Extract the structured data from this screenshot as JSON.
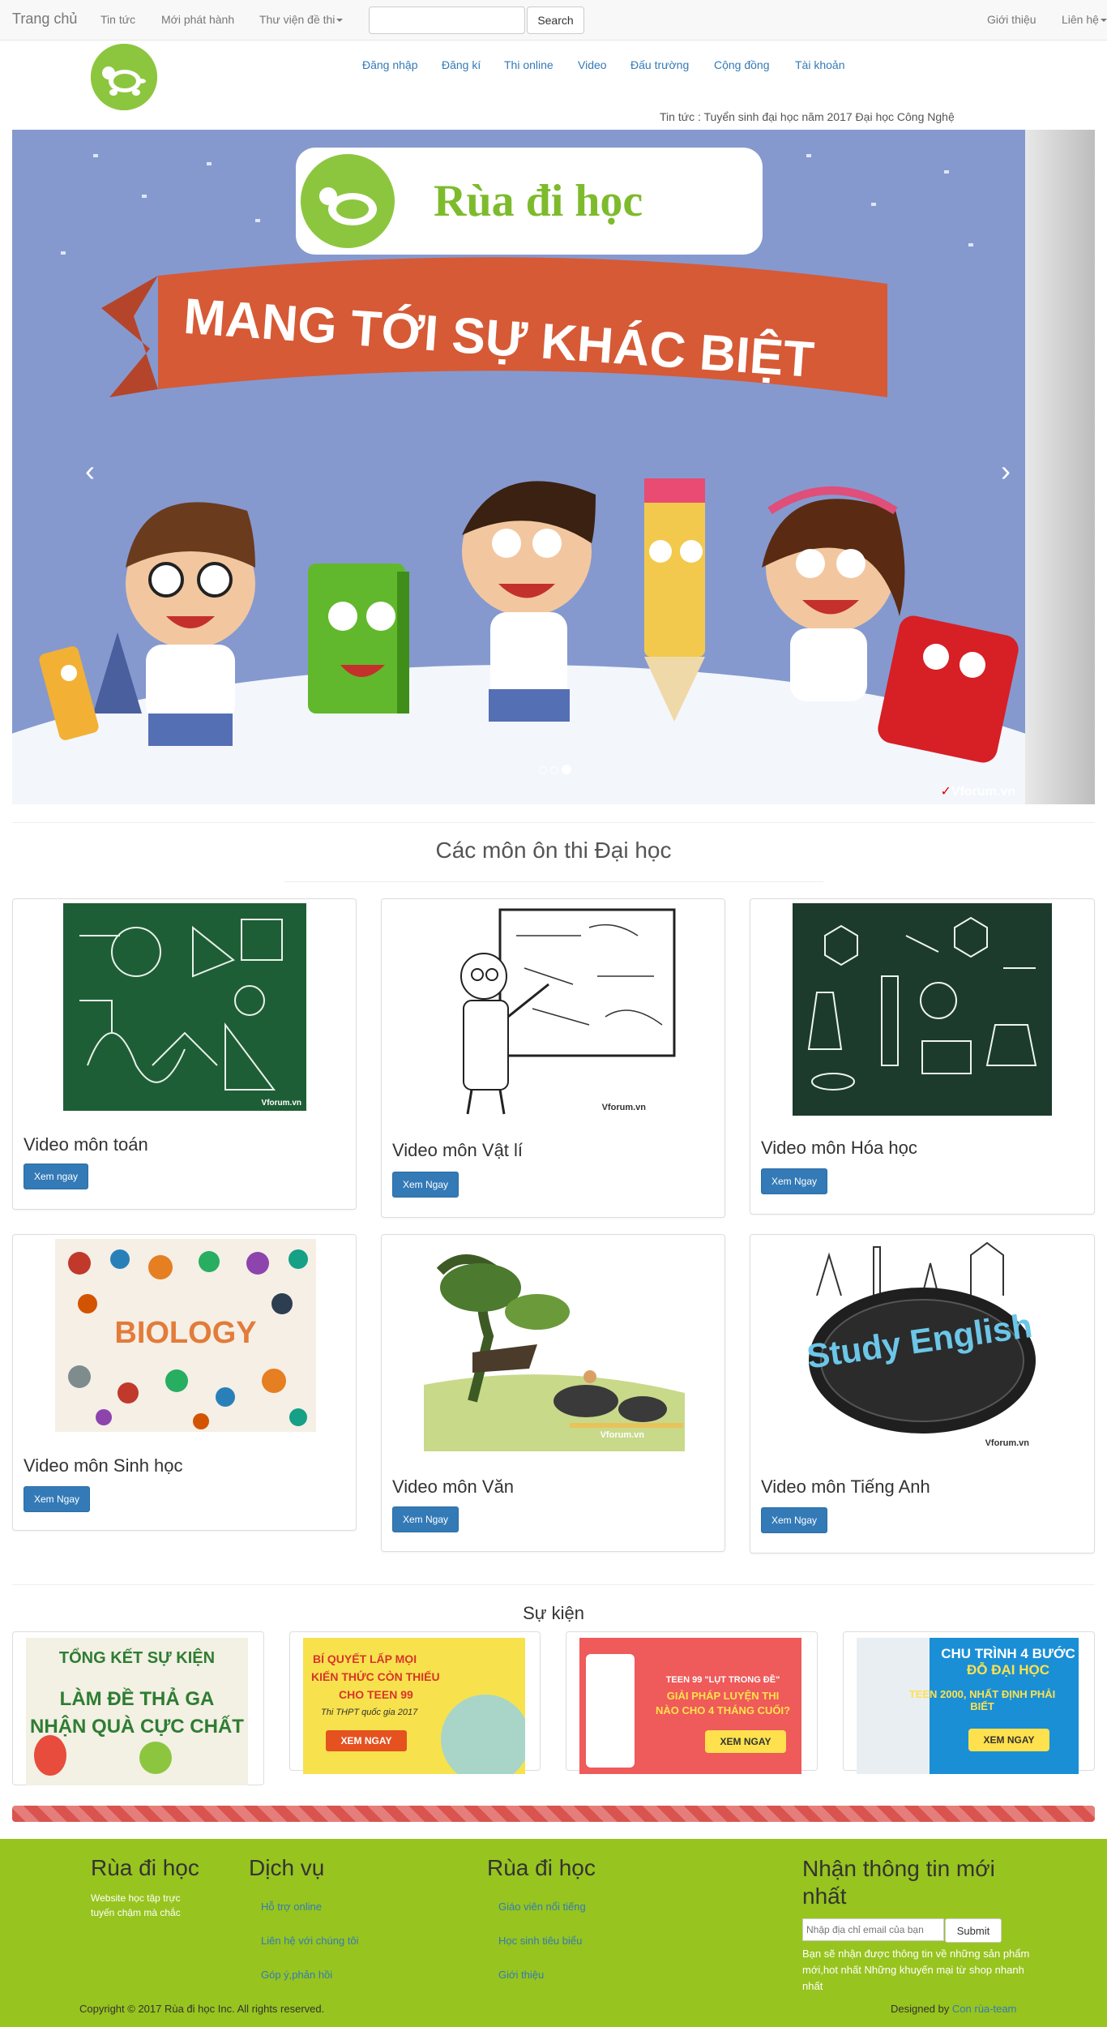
{
  "navbar": {
    "brand": "Trang chủ",
    "links": [
      "Tin tức",
      "Mới phát hành",
      "Thư viện đề thi"
    ],
    "search_button": "Search",
    "right_links": [
      "Giới thiệu",
      "Liên hệ"
    ]
  },
  "header": {
    "menu": [
      "Đăng nhập",
      "Đăng kí",
      "Thi online",
      "Video",
      "Đấu trường",
      "Cộng đồng",
      "Tài khoản"
    ],
    "news_ticker": "Tin tức : Tuyển sinh đại học năm 2017 Đại học Công Nghệ"
  },
  "carousel": {
    "logo_text": "Rùa đi học",
    "ribbon_text": "MANG TỚI SỰ KHÁC BIỆT",
    "watermark": "Vforum.vn",
    "prev_icon": "‹",
    "next_icon": "›"
  },
  "subjects": {
    "title": "Các môn ôn thi Đại học",
    "items": [
      {
        "title": "Video môn toán",
        "button": "Xem ngay",
        "thumb_text": "",
        "watermark": "Vforum.vn"
      },
      {
        "title": "Video môn Vật lí",
        "button": "Xem Ngay",
        "thumb_text": "",
        "watermark": "Vforum.vn"
      },
      {
        "title": "Video môn Hóa học",
        "button": "Xem Ngay",
        "thumb_text": "",
        "watermark": ""
      },
      {
        "title": "Video môn Sinh học",
        "button": "Xem Ngay",
        "thumb_text": "BIOLOGY",
        "watermark": ""
      },
      {
        "title": "Video môn Văn",
        "button": "Xem Ngay",
        "thumb_text": "",
        "watermark": "Vforum.vn"
      },
      {
        "title": "Video môn Tiếng Anh",
        "button": "Xem Ngay",
        "thumb_text": "Study English",
        "watermark": "Vforum.vn"
      }
    ]
  },
  "events": {
    "title": "Sự kiện",
    "items": [
      {
        "line1": "TỔNG KẾT SỰ KIỆN",
        "line2": "LÀM ĐỀ THẢ GA",
        "line3": "NHẬN QUÀ CỰC CHẤT",
        "button": ""
      },
      {
        "line1": "BÍ QUYẾT LẤP MỌI",
        "line2": "KIẾN THỨC CÒN THIẾU",
        "line3": "CHO TEEN 99",
        "sub": "Thi THPT quốc gia 2017",
        "button": "XEM NGAY"
      },
      {
        "line1": "TEEN 99 \"LỤT TRONG ĐỀ\"",
        "line2": "GIẢI PHÁP LUYỆN THI",
        "line3": "NÀO CHO 4 THÁNG CUỐI?",
        "button": "XEM NGAY"
      },
      {
        "line1": "CHU TRÌNH 4 BƯỚC",
        "line2": "ĐỖ ĐẠI HỌC",
        "line3": "TEEN 2000, NHẤT ĐỊNH PHẢI BIẾT",
        "button": "XEM NGAY"
      }
    ]
  },
  "footer": {
    "col1_title": "Rùa đi học",
    "col1_text": "Website học tập trực tuyến chậm mà chắc",
    "col2_title": "Dịch vụ",
    "col2_links": [
      "Hỗ trợ online",
      "Liên hệ với chúng tôi",
      "Góp ý,phản hồi"
    ],
    "col3_title": "Rùa đi học",
    "col3_links": [
      "Giáo viên nổi tiếng",
      "Học sinh tiêu biểu",
      "Giới thiệu"
    ],
    "col4_title": "Nhận thông tin mới nhất",
    "email_placeholder": "Nhập địa chỉ email của bạn",
    "submit": "Submit",
    "col4_text": "Bạn sẽ nhận được thông tin về những sản phẩm mới,hot nhất Những khuyến mại từ shop nhanh nhất",
    "copyright": "Copyright © 2017 Rùa đi học Inc. All rights reserved.",
    "designed_by": "Designed by",
    "designer": "Con rùa-team"
  }
}
